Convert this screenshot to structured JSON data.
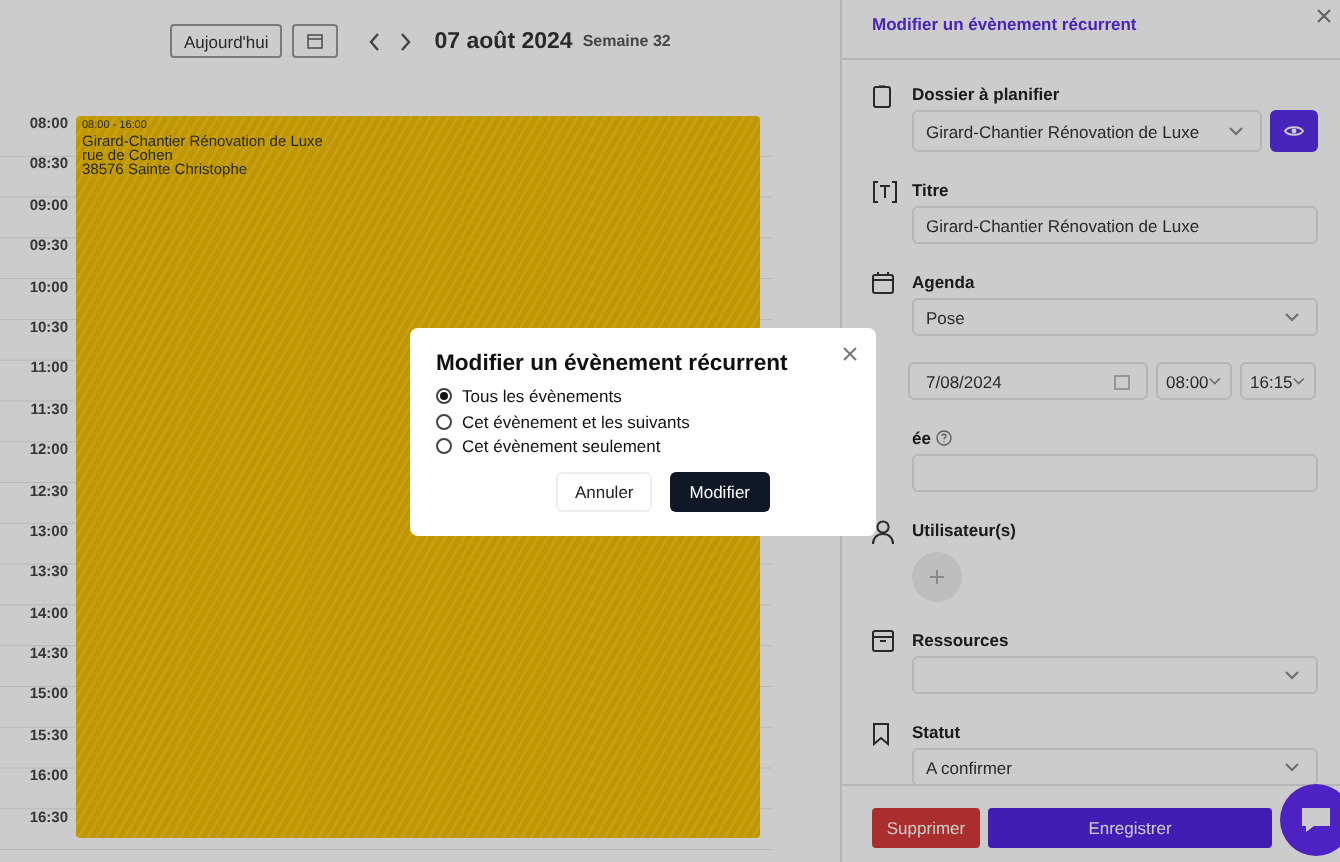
{
  "calendar": {
    "today_button": "Aujourd'hui",
    "date": "07 août 2024",
    "week": "Semaine 32",
    "time_slots": [
      "08:00",
      "08:30",
      "09:00",
      "09:30",
      "10:00",
      "10:30",
      "11:00",
      "11:30",
      "12:00",
      "12:30",
      "13:00",
      "13:30",
      "14:00",
      "14:30",
      "15:00",
      "15:30",
      "16:00",
      "16:30"
    ],
    "event": {
      "time": "08:00 - 16:00",
      "title": "Girard-Chantier Rénovation de Luxe",
      "address_lines": [
        "rue de Cohen",
        "38576 Sainte Christophe"
      ]
    }
  },
  "panel": {
    "title": "Modifier un évènement récurrent",
    "fields": [
      {
        "kind": "select-action",
        "label": "Dossier à planifier",
        "value": "Girard-Chantier Rénovation de Luxe"
      },
      {
        "kind": "text",
        "label": "Titre",
        "value": "Girard-Chantier Rénovation de Luxe"
      },
      {
        "kind": "select",
        "label": "Agenda",
        "value": "Pose"
      },
      {
        "kind": "datetime",
        "date": "7/08/2024",
        "start": "08:00",
        "end": "16:15"
      },
      {
        "kind": "text",
        "label": "ée",
        "help": true
      },
      {
        "kind": "users",
        "label": "Utilisateur(s)"
      },
      {
        "kind": "select",
        "label": "Ressources"
      },
      {
        "kind": "select",
        "label": "Statut",
        "value": "A confirmer"
      }
    ],
    "buttons": {
      "delete": "Supprimer",
      "save": "Enregistrer"
    }
  },
  "dialog": {
    "title": "Modifier un évènement récurrent",
    "options": [
      {
        "label": "Tous les évènements",
        "selected": true
      },
      {
        "label": "Cet évènement et les suivants",
        "selected": false
      },
      {
        "label": "Cet évènement seulement",
        "selected": false
      }
    ],
    "cancel": "Annuler",
    "confirm": "Modifier"
  }
}
